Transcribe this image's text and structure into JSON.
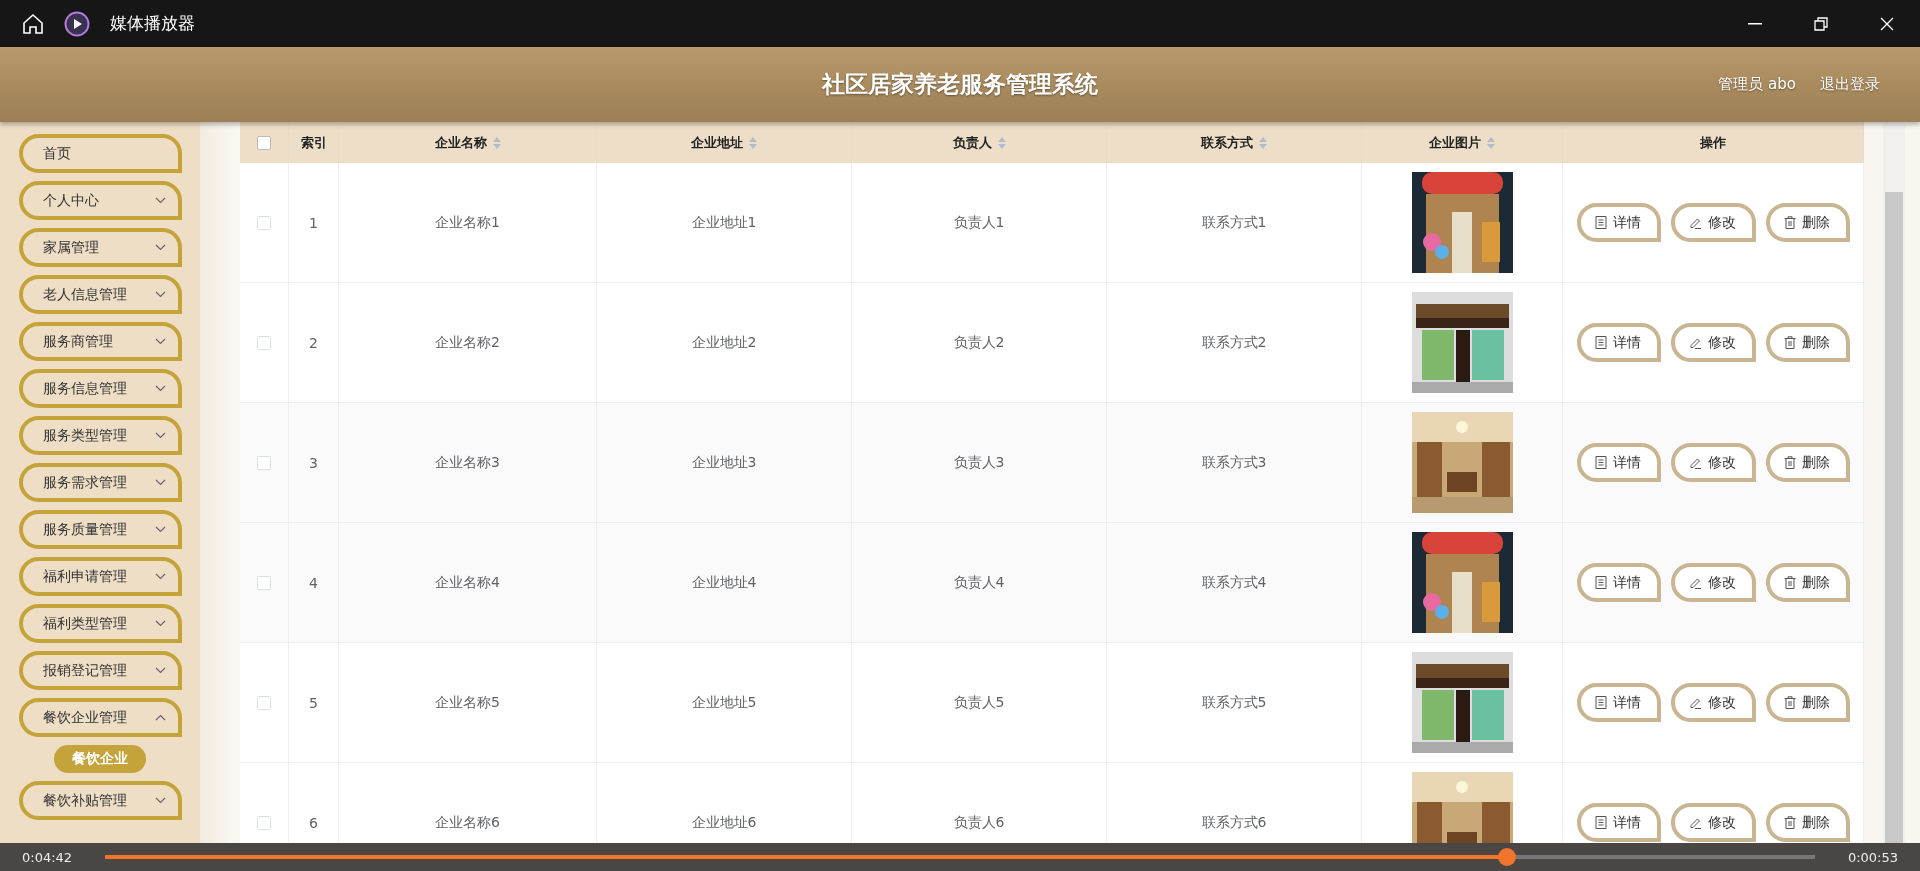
{
  "player": {
    "title": "媒体播放器",
    "elapsed": "0:04:42",
    "remaining": "0:00:53",
    "level": 0.82
  },
  "header": {
    "title": "社区居家养老服务管理系统",
    "user": "管理员 abo",
    "logout": "退出登录"
  },
  "sidebar": {
    "items": [
      {
        "label": "首页",
        "kind": "link"
      },
      {
        "label": "个人中心",
        "kind": "group",
        "expanded": false
      },
      {
        "label": "家属管理",
        "kind": "group",
        "expanded": false
      },
      {
        "label": "老人信息管理",
        "kind": "group",
        "expanded": false
      },
      {
        "label": "服务商管理",
        "kind": "group",
        "expanded": false
      },
      {
        "label": "服务信息管理",
        "kind": "group",
        "expanded": false
      },
      {
        "label": "服务类型管理",
        "kind": "group",
        "expanded": false
      },
      {
        "label": "服务需求管理",
        "kind": "group",
        "expanded": false
      },
      {
        "label": "服务质量管理",
        "kind": "group",
        "expanded": false
      },
      {
        "label": "福利申请管理",
        "kind": "group",
        "expanded": false
      },
      {
        "label": "福利类型管理",
        "kind": "group",
        "expanded": false
      },
      {
        "label": "报销登记管理",
        "kind": "group",
        "expanded": false
      },
      {
        "label": "餐饮企业管理",
        "kind": "group",
        "expanded": true,
        "children": [
          {
            "label": "餐饮企业",
            "selected": true
          }
        ]
      },
      {
        "label": "餐饮补贴管理",
        "kind": "group",
        "expanded": false
      }
    ]
  },
  "table": {
    "select_all": {
      "checked": false
    },
    "columns": [
      {
        "label": "索引",
        "sortable": false
      },
      {
        "label": "企业名称",
        "sortable": true
      },
      {
        "label": "企业地址",
        "sortable": true
      },
      {
        "label": "负责人",
        "sortable": true
      },
      {
        "label": "联系方式",
        "sortable": true
      },
      {
        "label": "企业图片",
        "sortable": true
      },
      {
        "label": "操作",
        "sortable": false
      }
    ],
    "rows": [
      {
        "checked": false,
        "cells": [
          "1",
          "企业名称1",
          "企业地址1",
          "负责人1",
          "联系方式1"
        ],
        "image": {
          "kind": "picture"
        },
        "actions": [
          {
            "label": "详情",
            "kind": "detail"
          },
          {
            "label": "修改",
            "kind": "edit"
          },
          {
            "label": "删除",
            "kind": "delete"
          }
        ]
      },
      {
        "checked": false,
        "cells": [
          "2",
          "企业名称2",
          "企业地址2",
          "负责人2",
          "联系方式2"
        ],
        "image": {
          "kind": "picture"
        },
        "actions": [
          {
            "label": "详情",
            "kind": "detail"
          },
          {
            "label": "修改",
            "kind": "edit"
          },
          {
            "label": "删除",
            "kind": "delete"
          }
        ]
      },
      {
        "checked": false,
        "cells": [
          "3",
          "企业名称3",
          "企业地址3",
          "负责人3",
          "联系方式3"
        ],
        "image": {
          "kind": "picture"
        },
        "actions": [
          {
            "label": "详情",
            "kind": "detail"
          },
          {
            "label": "修改",
            "kind": "edit"
          },
          {
            "label": "删除",
            "kind": "delete"
          }
        ]
      },
      {
        "checked": false,
        "cells": [
          "4",
          "企业名称4",
          "企业地址4",
          "负责人4",
          "联系方式4"
        ],
        "image": {
          "kind": "picture"
        },
        "actions": [
          {
            "label": "详情",
            "kind": "detail"
          },
          {
            "label": "修改",
            "kind": "edit"
          },
          {
            "label": "删除",
            "kind": "delete"
          }
        ]
      },
      {
        "checked": false,
        "cells": [
          "5",
          "企业名称5",
          "企业地址5",
          "负责人5",
          "联系方式5"
        ],
        "image": {
          "kind": "picture"
        },
        "actions": [
          {
            "label": "详情",
            "kind": "detail"
          },
          {
            "label": "修改",
            "kind": "edit"
          },
          {
            "label": "删除",
            "kind": "delete"
          }
        ]
      },
      {
        "checked": false,
        "cells": [
          "6",
          "企业名称6",
          "企业地址6",
          "负责人6",
          "联系方式6"
        ],
        "image": {
          "kind": "picture"
        },
        "actions": [
          {
            "label": "详情",
            "kind": "detail"
          },
          {
            "label": "修改",
            "kind": "edit"
          },
          {
            "label": "删除",
            "kind": "delete"
          }
        ]
      }
    ]
  }
}
